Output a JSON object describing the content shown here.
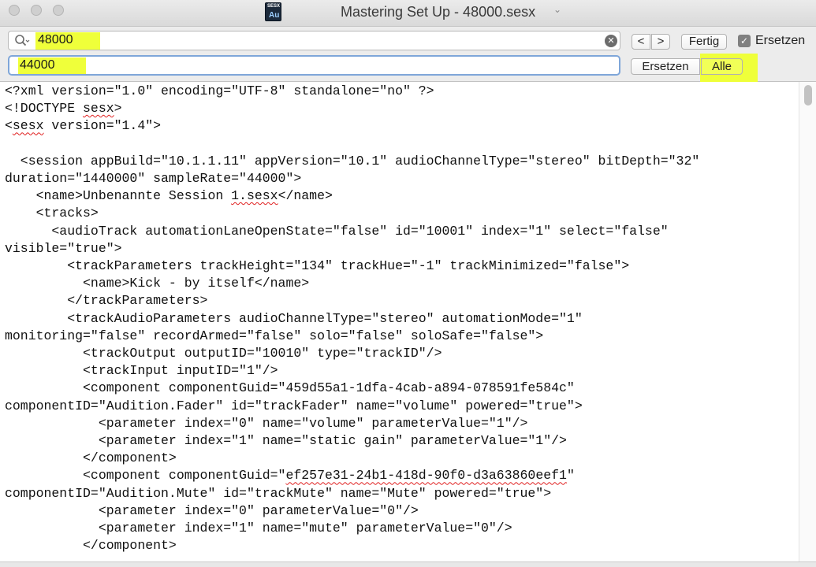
{
  "window": {
    "title": "Mastering Set Up - 48000.sesx",
    "doc_icon_top": "SESX",
    "doc_icon_label": "Au",
    "title_chevron": "⌄"
  },
  "find_bar": {
    "search_value": "48000",
    "replace_value": "44000",
    "prev_label": "<",
    "next_label": ">",
    "done_label": "Fertig",
    "replace_checkbox_label": "Ersetzen",
    "replace_checked": true,
    "replace_button_label": "Ersetzen",
    "replace_all_label": "Alle",
    "highlight_color": "#efff3a"
  },
  "editor": {
    "lines": [
      [
        "<?xml version=\"1.0\" encoding=\"UTF-8\" standalone=\"no\" ?>"
      ],
      [
        "<!DOCTYPE ",
        {
          "t": "sesx",
          "err": true
        },
        ">"
      ],
      [
        "<",
        {
          "t": "sesx",
          "err": true
        },
        " version=\"1.4\">"
      ],
      [
        ""
      ],
      [
        "  <session appBuild=\"10.1.1.11\" appVersion=\"10.1\" audioChannelType=\"stereo\" bitDepth=\"32\""
      ],
      [
        "duration=\"1440000\" sampleRate=\"44000\">"
      ],
      [
        "    <name>Unbenannte Session ",
        {
          "t": "1.sesx",
          "err": true
        },
        "</name>"
      ],
      [
        "    <tracks>"
      ],
      [
        "      <audioTrack automationLaneOpenState=\"false\" id=\"10001\" index=\"1\" select=\"false\""
      ],
      [
        "visible=\"true\">"
      ],
      [
        "        <trackParameters trackHeight=\"134\" trackHue=\"-1\" trackMinimized=\"false\">"
      ],
      [
        "          <name>Kick - by itself</name>"
      ],
      [
        "        </trackParameters>"
      ],
      [
        "        <trackAudioParameters audioChannelType=\"stereo\" automationMode=\"1\""
      ],
      [
        "monitoring=\"false\" recordArmed=\"false\" solo=\"false\" soloSafe=\"false\">"
      ],
      [
        "          <trackOutput outputID=\"10010\" type=\"trackID\"/>"
      ],
      [
        "          <trackInput inputID=\"1\"/>"
      ],
      [
        "          <component componentGuid=\"459d55a1-1dfa-4cab-a894-078591fe584c\""
      ],
      [
        "componentID=\"Audition.Fader\" id=\"trackFader\" name=\"volume\" powered=\"true\">"
      ],
      [
        "            <parameter index=\"0\" name=\"volume\" parameterValue=\"1\"/>"
      ],
      [
        "            <parameter index=\"1\" name=\"static gain\" parameterValue=\"1\"/>"
      ],
      [
        "          </component>"
      ],
      [
        "          <component componentGuid=\"",
        {
          "t": "ef257e31-24b1-418d-90f0-d3a63860eef1",
          "err": true
        },
        "\""
      ],
      [
        "componentID=\"Audition.Mute\" id=\"trackMute\" name=\"Mute\" powered=\"true\">"
      ],
      [
        "            <parameter index=\"0\" parameterValue=\"0\"/>"
      ],
      [
        "            <parameter index=\"1\" name=\"mute\" parameterValue=\"0\"/>"
      ],
      [
        "          </component>"
      ]
    ]
  }
}
